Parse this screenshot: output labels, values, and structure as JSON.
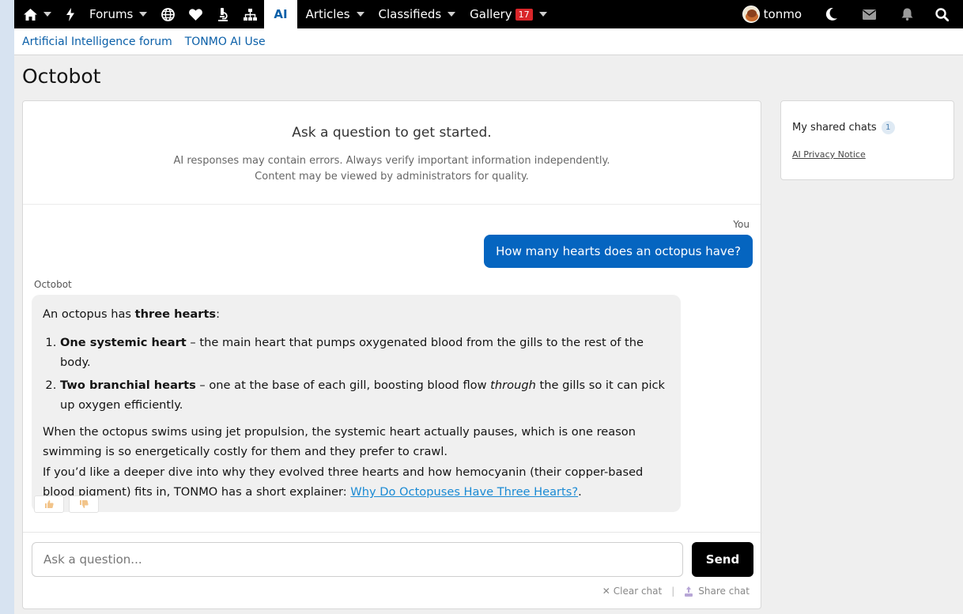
{
  "nav": {
    "forums_label": "Forums",
    "ai_label": "AI",
    "articles_label": "Articles",
    "classifieds_label": "Classifieds",
    "gallery_label": "Gallery",
    "gallery_badge": "17",
    "username": "tonmo"
  },
  "breadcrumbs": [
    "Artificial Intelligence forum",
    "TONMO AI Use"
  ],
  "page": {
    "title": "Octobot"
  },
  "intro": {
    "title": "Ask a question to get started.",
    "note_line1": "AI responses may contain errors. Always verify important information independently.",
    "note_line2": "Content may be viewed by administrators for quality."
  },
  "conversation": {
    "user_label": "You",
    "user_message": "How many hearts does an octopus have?",
    "bot_label": "Octobot",
    "bot": {
      "intro_pre": "An octopus has ",
      "intro_bold": "three hearts",
      "intro_post": ":",
      "item1_bold": "One systemic heart",
      "item1_text": " – the main heart that pumps oxygenated blood from the gills to the rest of the body.",
      "item2_bold": "Two branchial hearts",
      "item2_text_a": " – one at the base of each gill, boosting blood flow ",
      "item2_italic": "through",
      "item2_text_b": " the gills so it can pick up oxygen efficiently.",
      "para1": "When the octopus swims using jet propulsion, the systemic heart actually pauses, which is one reason swimming is so energetically costly for them and they prefer to crawl.",
      "para2_pre": "If you’d like a deeper dive into why they evolved three hearts and how hemocyanin (their copper-based blood pigment) fits in, TONMO has a short explainer: ",
      "link_text": "Why Do Octopuses Have Three Hearts?",
      "para2_post": "."
    }
  },
  "composer": {
    "placeholder": "Ask a question...",
    "send_label": "Send",
    "clear_label": "Clear chat",
    "share_label": "Share chat"
  },
  "sidebar": {
    "shared_label": "My shared chats",
    "shared_count": "1",
    "privacy_label": "AI Privacy Notice"
  },
  "colors": {
    "accent": "#0565c0",
    "nav_bg": "#000000",
    "badge": "#d9262a"
  }
}
